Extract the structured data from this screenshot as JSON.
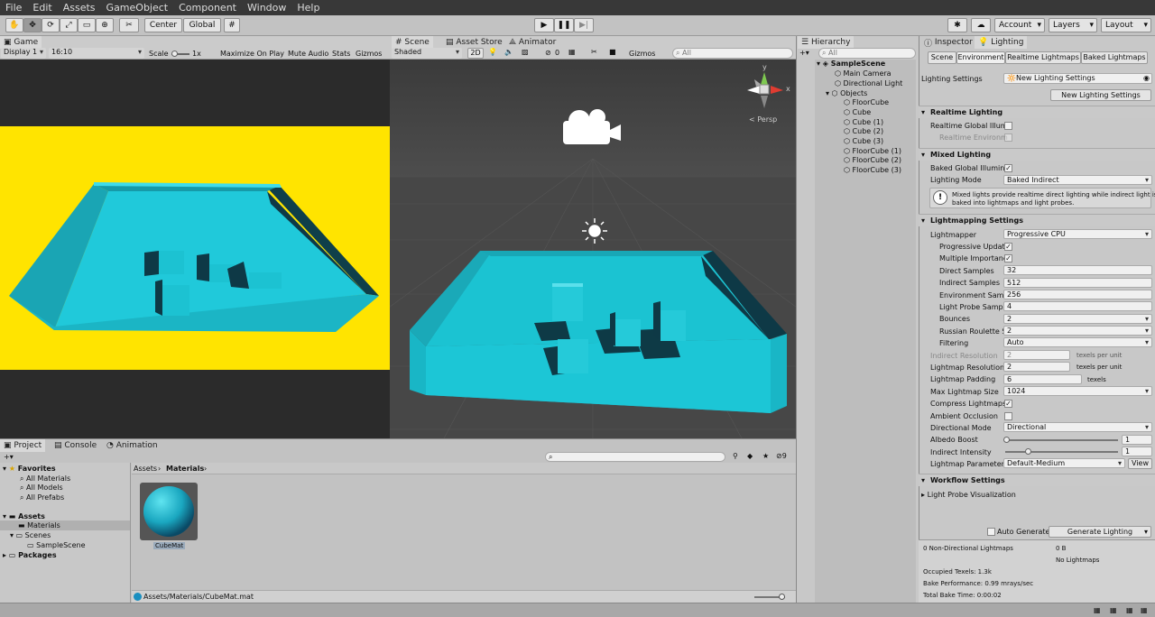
{
  "menu": [
    "File",
    "Edit",
    "Assets",
    "GameObject",
    "Component",
    "Window",
    "Help"
  ],
  "toolbar": {
    "center": "Center",
    "global": "Global",
    "account": "Account",
    "layers": "Layers",
    "layout": "Layout"
  },
  "game": {
    "tab": "Game",
    "display": "Display 1",
    "aspect": "16:10",
    "scale_label": "Scale",
    "scale_value": "1x",
    "options": [
      "Maximize On Play",
      "Mute Audio",
      "Stats",
      "Gizmos"
    ]
  },
  "scene": {
    "tabs": [
      "Scene",
      "Asset Store",
      "Animator"
    ],
    "shading": "Shaded",
    "mode2d": "2D",
    "fx_count": "0",
    "gizmos": "Gizmos",
    "search_placeholder": "All",
    "persp": "< Persp",
    "gizmo_y": "y",
    "gizmo_x": "x"
  },
  "hierarchy": {
    "tab": "Hierarchy",
    "search_placeholder": "All",
    "scene": "SampleScene",
    "items": [
      "Main Camera",
      "Directional Light",
      "Objects",
      "FloorCube",
      "Cube",
      "Cube (1)",
      "Cube (2)",
      "Cube (3)",
      "FloorCube (1)",
      "FloorCube (2)",
      "FloorCube (3)"
    ]
  },
  "inspector": {
    "tabs": [
      "Inspector",
      "Lighting"
    ],
    "subtabs": [
      "Scene",
      "Environment",
      "Realtime Lightmaps",
      "Baked Lightmaps"
    ],
    "lighting_settings_label": "Lighting Settings",
    "lighting_settings_value": "New Lighting Settings",
    "new_lighting_button": "New Lighting Settings",
    "realtime_section": "Realtime Lighting",
    "realtime_gi": "Realtime Global Illumi",
    "realtime_env": "Realtime Environm",
    "mixed_section": "Mixed Lighting",
    "baked_gi": "Baked Global Illumina",
    "lighting_mode_label": "Lighting Mode",
    "lighting_mode_value": "Baked Indirect",
    "info_line1": "Mixed lights provide realtime direct lighting while indirect light is",
    "info_line2": "baked into lightmaps and light probes.",
    "lightmapping_section": "Lightmapping Settings",
    "lightmapper_label": "Lightmapper",
    "lightmapper_value": "Progressive CPU",
    "progressive_updates": "Progressive Updat",
    "multiple_importance": "Multiple Importanc",
    "direct_samples_label": "Direct Samples",
    "direct_samples": "32",
    "indirect_samples_label": "Indirect Samples",
    "indirect_samples": "512",
    "env_samples_label": "Environment Samp",
    "env_samples": "256",
    "probe_samples_label": "Light Probe Sample",
    "probe_samples": "4",
    "bounces_label": "Bounces",
    "bounces": "2",
    "roulette_label": "Russian Roulette S",
    "roulette": "2",
    "filtering_label": "Filtering",
    "filtering": "Auto",
    "indirect_res_label": "Indirect Resolution",
    "indirect_res": "2",
    "texels_per_unit": "texels per unit",
    "lightmap_res_label": "Lightmap Resolution",
    "lightmap_res": "2",
    "padding_label": "Lightmap Padding",
    "padding": "6",
    "texels": "texels",
    "max_size_label": "Max Lightmap Size",
    "max_size": "1024",
    "compress_label": "Compress Lightmaps",
    "ao_label": "Ambient Occlusion",
    "directional_label": "Directional Mode",
    "directional": "Directional",
    "albedo_label": "Albedo Boost",
    "albedo": "1",
    "indirect_int_label": "Indirect Intensity",
    "indirect_int": "1",
    "params_label": "Lightmap Parameters",
    "params": "Default-Medium",
    "view_button": "View",
    "workflow_section": "Workflow Settings",
    "probe_vis": "Light Probe Visualization",
    "auto_generate": "Auto Generate",
    "generate_button": "Generate Lighting",
    "stats": {
      "nondirectional": "0 Non-Directional Lightmaps",
      "size": "0 B",
      "no_lightmaps": "No Lightmaps",
      "occupied": "Occupied Texels: 1.3k",
      "bake_perf": "Bake Performance: 0.99 mrays/sec",
      "bake_time": "Total Bake Time: 0:00:02"
    }
  },
  "project": {
    "tabs": [
      "Project",
      "Console",
      "Animation"
    ],
    "favorites": "Favorites",
    "fav_items": [
      "All Materials",
      "All Models",
      "All Prefabs"
    ],
    "assets": "Assets",
    "materials": "Materials",
    "scenes": "Scenes",
    "sample_scene": "SampleScene",
    "packages": "Packages",
    "breadcrumb_root": "Assets",
    "breadcrumb_current": "Materials",
    "asset_name": "CubeMat",
    "path": "Assets/Materials/CubeMat.mat",
    "hidden_count": "9"
  },
  "colors": {
    "cyan": "#1cc8d8",
    "yellow": "#ffe400",
    "scene_bg": "#474747"
  }
}
